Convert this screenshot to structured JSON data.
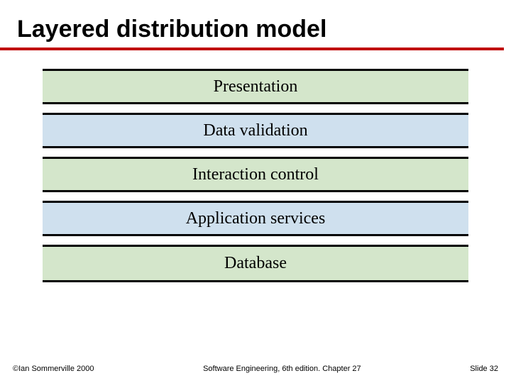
{
  "title": "Layered distribution model",
  "layers": {
    "l0": "Presentation",
    "l1": "Data validation",
    "l2": "Interaction control",
    "l3": "Application services",
    "l4": "Database"
  },
  "footer": {
    "left": "©Ian Sommerville 2000",
    "center": "Software Engineering, 6th edition. Chapter 27",
    "right": "Slide 32"
  }
}
